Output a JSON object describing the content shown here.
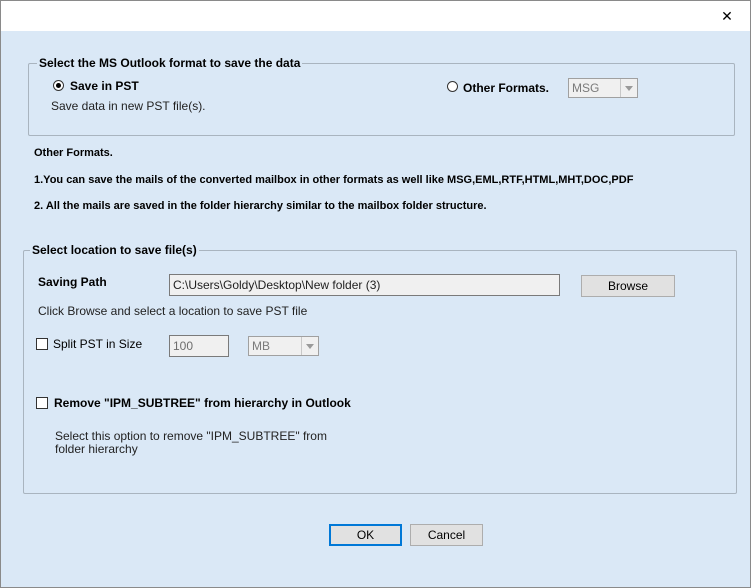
{
  "titlebar": {
    "close_glyph": "✕"
  },
  "format_group": {
    "title": "Select the MS Outlook format to save the data",
    "save_pst_label": "Save in PST",
    "save_pst_desc": "Save data in new PST file(s).",
    "other_formats_label": "Other Formats.",
    "format_select_value": "MSG"
  },
  "info": {
    "heading": "Other Formats.",
    "line1": "1.You can save the mails of the converted mailbox in other formats as well like MSG,EML,RTF,HTML,MHT,DOC,PDF",
    "line2": "2. All the mails are saved in the folder hierarchy similar to the mailbox folder structure."
  },
  "location_group": {
    "title": "Select location to save file(s)",
    "saving_path_label": "Saving Path",
    "saving_path_value": "C:\\Users\\Goldy\\Desktop\\New folder (3)",
    "browse_label": "Browse",
    "browse_hint": "Click Browse and select a location to save PST file",
    "split_label": "Split PST in Size",
    "split_size_value": "100",
    "split_unit_value": "MB",
    "remove_label": "Remove \"IPM_SUBTREE\" from hierarchy in Outlook",
    "remove_desc_line1": "Select this option to remove \"IPM_SUBTREE\" from",
    "remove_desc_line2": "folder hierarchy"
  },
  "footer": {
    "ok_label": "OK",
    "cancel_label": "Cancel"
  }
}
